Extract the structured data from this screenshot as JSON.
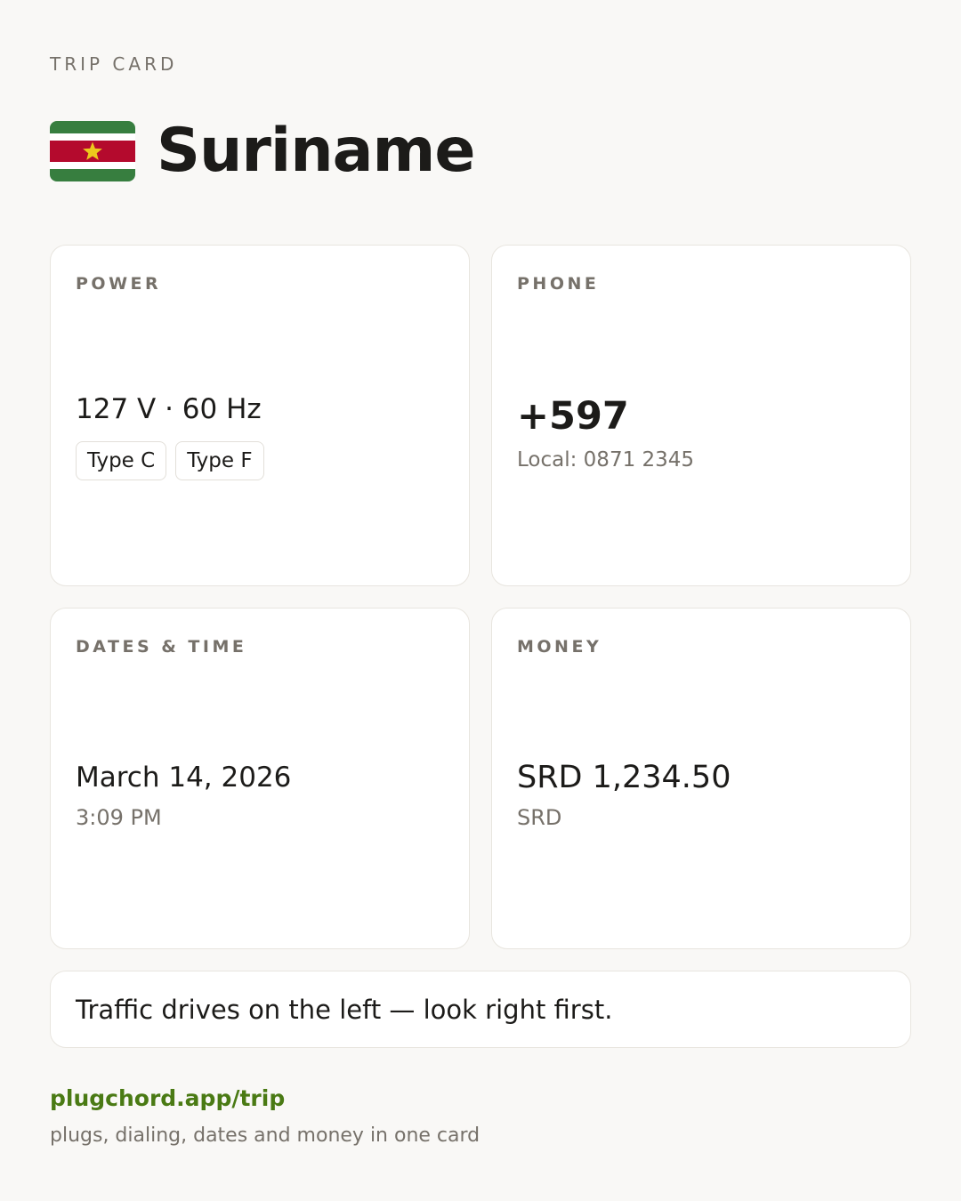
{
  "header": {
    "eyebrow": "TRIP CARD",
    "country": "Suriname",
    "flag": {
      "icon": "suriname-flag-icon",
      "colors": {
        "green": "#377e3f",
        "white": "#ffffff",
        "red": "#b40a2d",
        "star": "#ecc81d"
      }
    }
  },
  "power": {
    "label": "POWER",
    "value": "127 V · 60 Hz",
    "plugs": [
      "Type C",
      "Type F"
    ]
  },
  "phone": {
    "label": "PHONE",
    "code": "+597",
    "local": "Local: 0871 2345"
  },
  "datetime": {
    "label": "DATES & TIME",
    "date": "March 14, 2026",
    "time": "3:09 PM"
  },
  "money": {
    "label": "MONEY",
    "amount": "SRD 1,234.50",
    "currency": "SRD"
  },
  "note": {
    "text": "Traffic drives on the left — look right first."
  },
  "footer": {
    "link": "plugchord.app/trip",
    "tagline": "plugs, dialing, dates and money in one card"
  },
  "colors": {
    "background": "#f9f8f6",
    "accent": "#4a7a14",
    "muted": "#76716a"
  }
}
